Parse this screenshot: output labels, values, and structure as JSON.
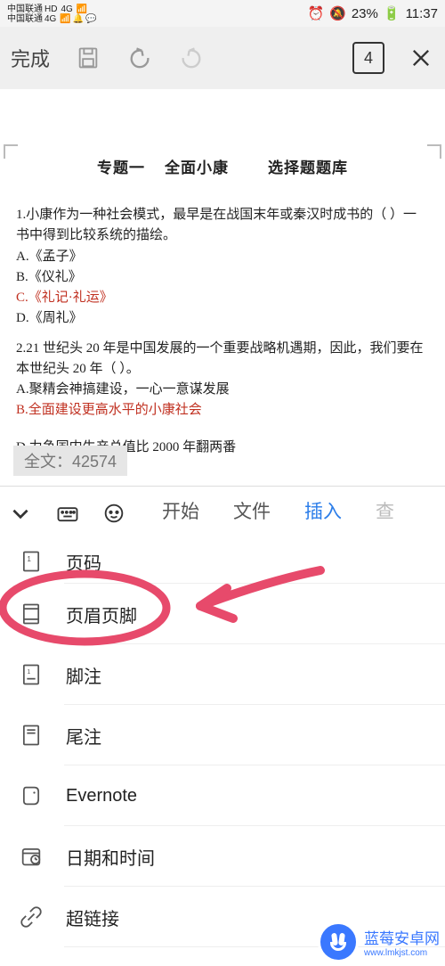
{
  "status_bar": {
    "carrier": "中国联通",
    "net_mode": "4G",
    "hd_label": "HD",
    "time": "11:37",
    "battery": "23%",
    "alarm_icon": "alarm",
    "mute_icon": "mute"
  },
  "toolbar": {
    "done_label": "完成",
    "page_count": "4"
  },
  "document": {
    "title_part1": "专题一",
    "title_part2": "全面小康",
    "title_part3": "选择题题库",
    "q1_stem": "1.小康作为一种社会模式，最早是在战国末年或秦汉时成书的（   ）一书中得到比较系统的描绘。",
    "q1_a": "A.《孟子》",
    "q1_b": "B.《仪礼》",
    "q1_c": "C.《礼记·礼运》",
    "q1_d": "D.《周礼》",
    "q2_stem": "2.21 世纪头 20 年是中国发展的一个重要战略机遇期，因此，我们要在本世纪头 20 年（   ）。",
    "q2_a": "A.聚精会神搞建设，一心一意谋发展",
    "q2_b": "B.全面建设更高水平的小康社会",
    "q2_d": "D.力争国内生产总值比 2000 年翻两番",
    "word_count_label": "全文：42574"
  },
  "tabs": {
    "start": "开始",
    "file": "文件",
    "insert": "插入",
    "more": "查"
  },
  "insert_menu": {
    "page_number": "页码",
    "header_footer": "页眉页脚",
    "footnote": "脚注",
    "endnote": "尾注",
    "evernote": "Evernote",
    "datetime": "日期和时间",
    "hyperlink": "超链接"
  },
  "watermark": {
    "text": "蓝莓安卓网",
    "url": "www.lmkjst.com"
  }
}
